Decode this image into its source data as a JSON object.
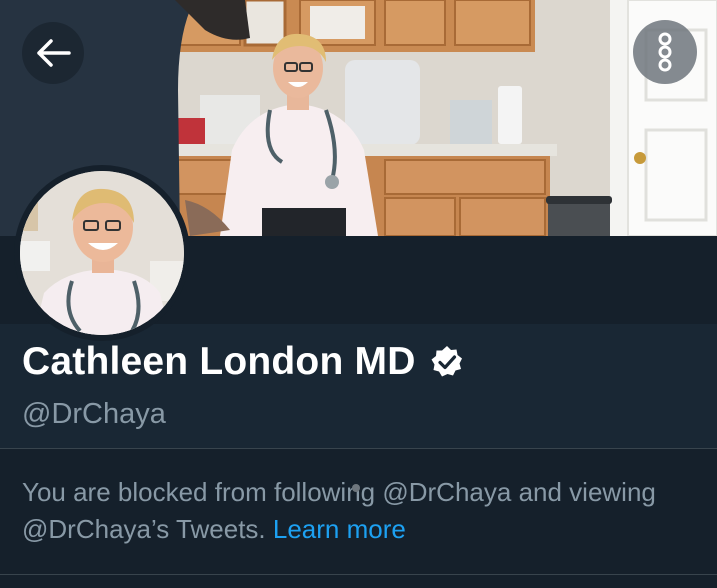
{
  "profile": {
    "display_name": "Cathleen London MD",
    "handle": "@DrChaya",
    "verified": true
  },
  "blocked_notice": {
    "message": "You are blocked from following @DrChaya and viewing @DrChaya’s Tweets.",
    "learn_more_label": "Learn more"
  },
  "icons": {
    "back": "back-arrow-icon",
    "more": "more-vertical-icon",
    "verified": "verified-badge-icon"
  },
  "colors": {
    "background": "#15202b",
    "info_panel": "#192734",
    "primary_text": "#ffffff",
    "secondary_text": "#8899a6",
    "link": "#1da1f2",
    "divider": "#38444d"
  }
}
